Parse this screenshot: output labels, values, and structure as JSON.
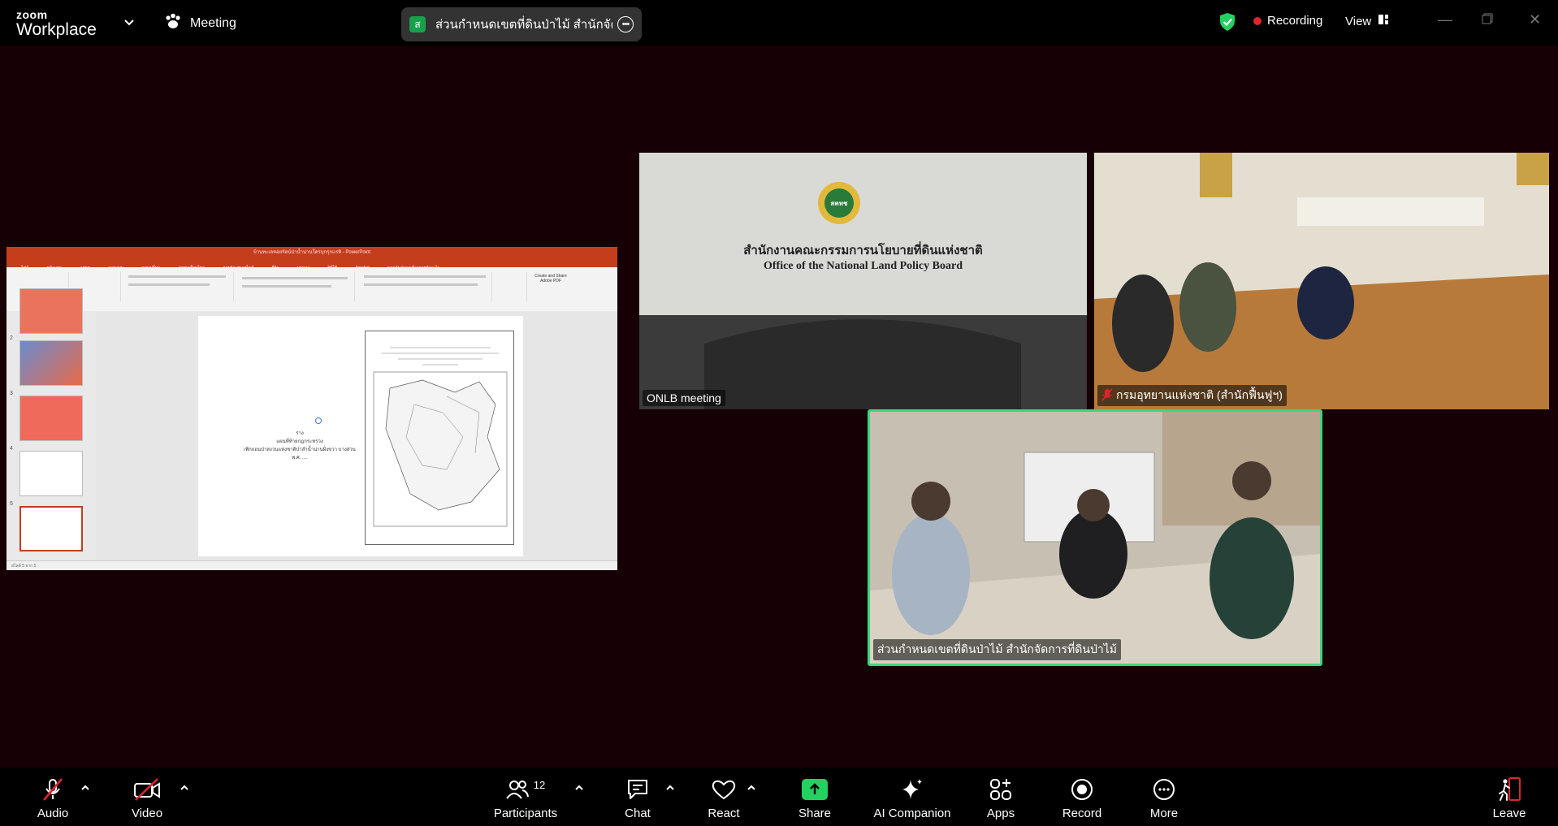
{
  "app": {
    "brand_top": "zoom",
    "brand_bottom": "Workplace"
  },
  "header": {
    "meeting_label": "Meeting",
    "active_speaker": {
      "avatar_letter": "ส",
      "name": "ส่วนกำหนดเขตที่ดินป่าไม้ สำนักจัดกา"
    },
    "recording_label": "Recording",
    "view_label": "View"
  },
  "shared_screen": {
    "window_title": "บ้านทะเลหอยรัตน์ป่าน้ำน่านใครบุกรุกแรทิ - PowerPoint",
    "ribbon_tabs": [
      "ไฟล์",
      "หน้าแรก",
      "แทรก",
      "ออกแบบ",
      "การเปลี่ยน",
      "ภาพเคลื่อนไหว",
      "การนำเสนอสไลด์",
      "รีวิว",
      "มุมมอง",
      "วิธีใช้",
      "Acrobat",
      "บอกฉันว่าคุณต้องการทำอะไร"
    ],
    "ribbon_button": "Create and Share Adobe PDF",
    "slide_numbers": [
      "2",
      "3",
      "4",
      "5"
    ],
    "slide_text": [
      "ร่าง",
      "แผนที่ท้ายกฎกระทรวง",
      "เพิกถอนป่าสงวนแห่งชาติป่าลำน้ำน่านฝั่งขวา บางส่วน",
      "พ.ศ. ...."
    ],
    "status_text": "สไลด์ 5 จาก 5"
  },
  "participants": [
    {
      "name": "ONLB meeting",
      "muted": false,
      "org_text_th": "สำนักงานคณะกรรมการนโยบายที่ดินแห่งชาติ",
      "org_text_en": "Office of the National Land Policy Board",
      "seal_text": "สคทช"
    },
    {
      "name": "กรมอุทยานแห่งชาติ (สำนักฟื้นฟูฯ)",
      "muted": true
    },
    {
      "name": "ส่วนกำหนดเขตที่ดินป่าไม้ สำนักจัดการที่ดินป่าไม้",
      "muted": false,
      "active_speaker": true
    }
  ],
  "toolbar": {
    "audio": "Audio",
    "video": "Video",
    "participants": "Participants",
    "participant_count": "12",
    "chat": "Chat",
    "react": "React",
    "share": "Share",
    "ai_companion": "AI Companion",
    "apps": "Apps",
    "record": "Record",
    "more": "More",
    "leave": "Leave"
  },
  "colors": {
    "share_green": "#23d160",
    "active_border": "#3dd67c",
    "recording_red": "#e0242e",
    "mute_red": "#e0242e",
    "ppt_orange": "#c43e1c"
  }
}
